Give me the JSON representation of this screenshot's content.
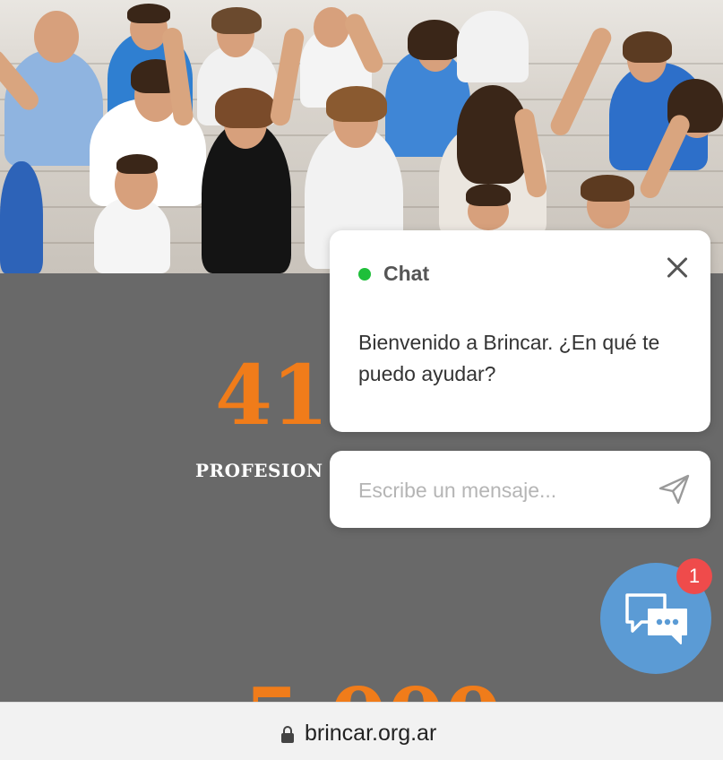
{
  "hero": {
    "photo_subject": "",
    "photo_icon": "group-photo"
  },
  "stats": {
    "first_number_visible": "41.",
    "first_label_visible": "PROFESION",
    "accent_color": "#f07c1a",
    "band_color": "#696969"
  },
  "chat": {
    "title": "Chat",
    "status_color": "#1fbf3a",
    "welcome_message": "Bienvenido a Brincar. ¿En qué te puedo ayudar?",
    "input_placeholder": "Escribe un mensaje...",
    "launcher_color": "#5b9bd5",
    "unread_count": "1",
    "badge_color": "#ef4b4b",
    "icons": {
      "close": "close-icon",
      "send": "send-icon",
      "launcher": "chat-bubbles-icon"
    }
  },
  "browser": {
    "url": "brincar.org.ar",
    "lock_icon": "lock-icon"
  }
}
